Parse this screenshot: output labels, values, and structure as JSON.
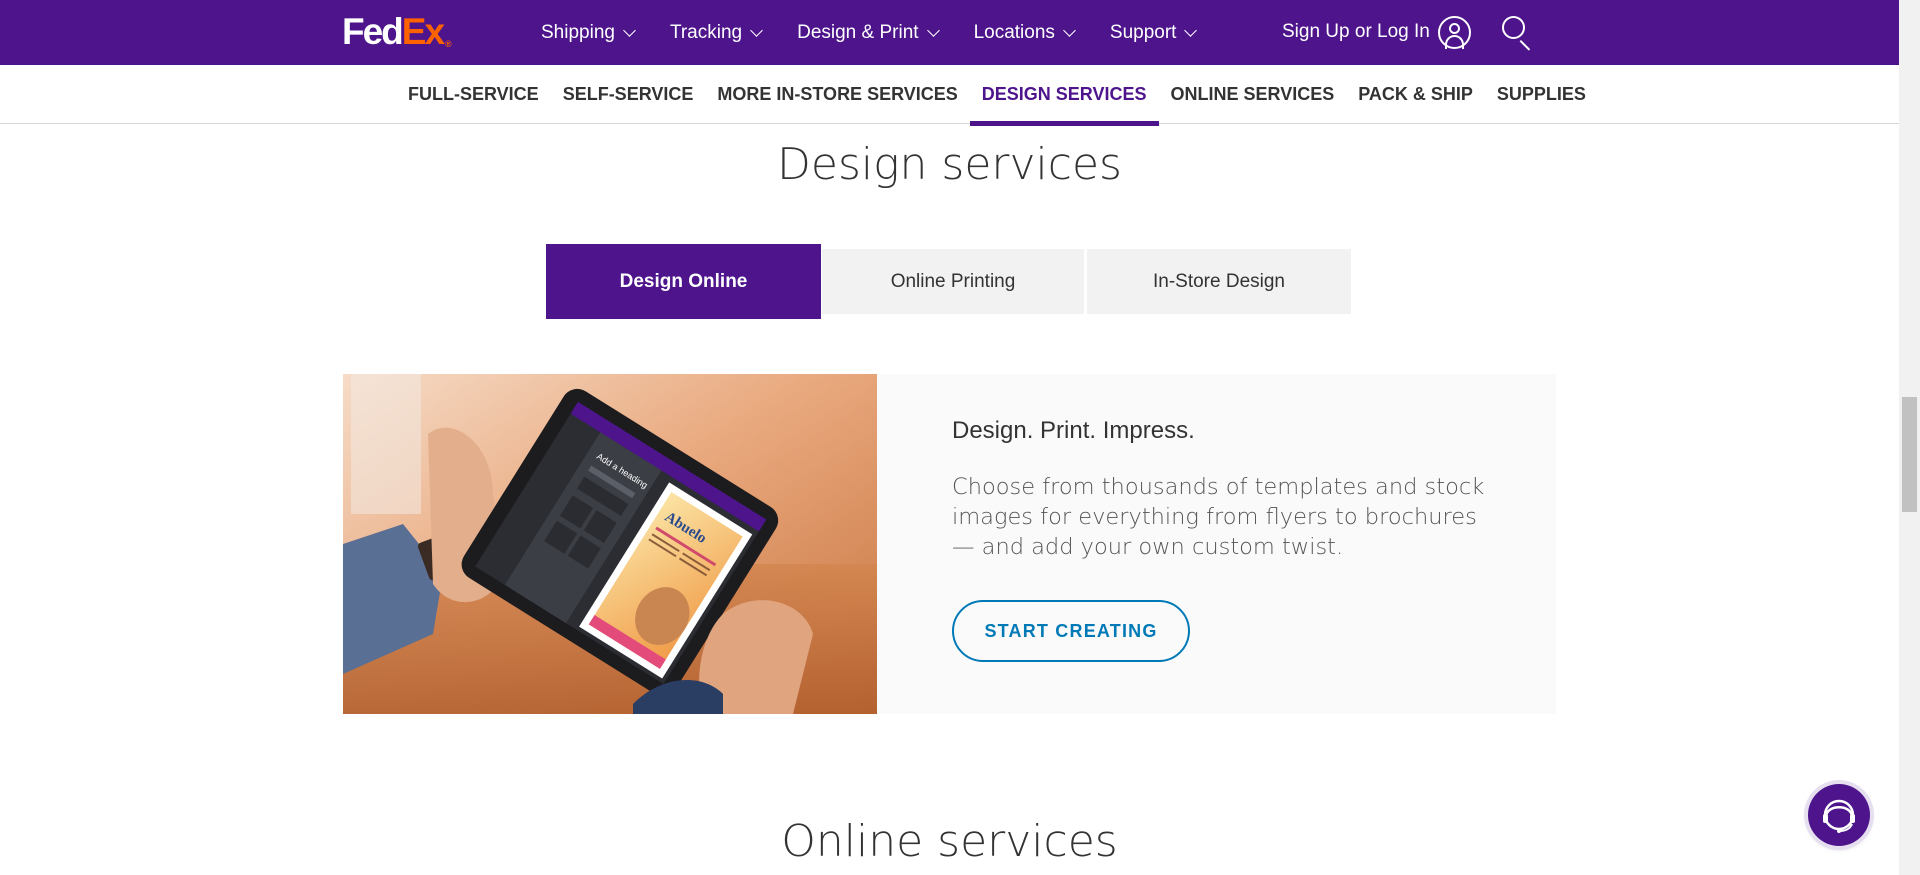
{
  "header": {
    "logo": {
      "fed": "Fed",
      "ex": "Ex",
      "reg": "®"
    },
    "menu": [
      {
        "label": "Shipping"
      },
      {
        "label": "Tracking"
      },
      {
        "label": "Design & Print"
      },
      {
        "label": "Locations"
      },
      {
        "label": "Support"
      }
    ],
    "login_label": "Sign Up or Log In"
  },
  "subnav": {
    "items": [
      {
        "label": "FULL-SERVICE"
      },
      {
        "label": "SELF-SERVICE"
      },
      {
        "label": "MORE IN-STORE SERVICES"
      },
      {
        "label": "DESIGN SERVICES",
        "active": true
      },
      {
        "label": "ONLINE SERVICES"
      },
      {
        "label": "PACK & SHIP"
      },
      {
        "label": "SUPPLIES"
      }
    ]
  },
  "design_section": {
    "title": "Design services",
    "tabs": [
      {
        "label": "Design Online",
        "active": true
      },
      {
        "label": "Online Printing"
      },
      {
        "label": "In-Store Design"
      }
    ],
    "card": {
      "heading": "Design. Print. Impress.",
      "body": "Choose from thousands of templates and stock images for everything from flyers to brochures — and add your own custom twist.",
      "cta_label": "START CREATING",
      "image": {
        "tablet_heading": "Add a heading",
        "menu_title": "Abuelo"
      }
    }
  },
  "online_section": {
    "title": "Online services"
  },
  "colors": {
    "brand_purple": "#4d148c",
    "brand_orange": "#ff6200",
    "cta_blue": "#007ab7"
  }
}
